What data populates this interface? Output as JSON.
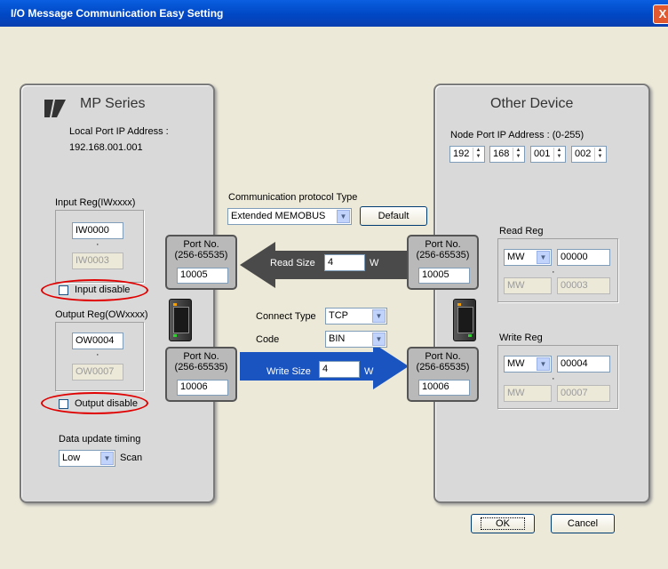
{
  "window": {
    "title": "I/O Message Communication Easy Setting",
    "close_glyph": "X"
  },
  "mp": {
    "title": "MP Series",
    "local_ip_label": "Local Port IP Address :",
    "local_ip_value": "192.168.001.001",
    "input_reg_label": "Input Reg(IWxxxx)",
    "input_start": "IW0000",
    "input_sep": "·",
    "input_end": "IW0003",
    "input_disable_label": "Input disable",
    "input_disable_checked": false,
    "output_reg_label": "Output Reg(OWxxxx)",
    "output_start": "OW0004",
    "output_sep": "·",
    "output_end": "OW0007",
    "output_disable_label": "Output disable",
    "output_disable_checked": false,
    "update_timing_label": "Data update timing",
    "update_timing_value": "Low",
    "scan_label": "Scan"
  },
  "middle": {
    "protocol_label": "Communication protocol Type",
    "protocol_value": "Extended MEMOBUS",
    "default_button": "Default",
    "port_label_1": "Port No.",
    "port_label_2": "(256-65535)",
    "mp_read_port": "10005",
    "mp_write_port": "10006",
    "dev_read_port": "10005",
    "dev_write_port": "10006",
    "read_size_label": "Read Size",
    "read_size_value": "4",
    "read_unit": "W",
    "write_size_label": "Write Size",
    "write_size_value": "4",
    "write_unit": "W",
    "connect_type_label": "Connect Type",
    "connect_type_value": "TCP",
    "code_label": "Code",
    "code_value": "BIN"
  },
  "other": {
    "title": "Other Device",
    "node_ip_label": "Node Port IP Address : (0-255)",
    "ip_octets": [
      "192",
      "168",
      "001",
      "002"
    ],
    "read_reg_label": "Read Reg",
    "read_type": "MW",
    "read_start": "00000",
    "read_type_end": "MW",
    "read_sep": "·",
    "read_end": "00003",
    "write_reg_label": "Write Reg",
    "write_type": "MW",
    "write_start": "00004",
    "write_type_end": "MW",
    "write_sep": "·",
    "write_end": "00007"
  },
  "buttons": {
    "ok": "OK",
    "cancel": "Cancel"
  },
  "colors": {
    "title_bar": "#0047c4",
    "read_arrow": "#4a4a4a",
    "write_arrow": "#1a54c0",
    "highlight": "#e00000"
  }
}
